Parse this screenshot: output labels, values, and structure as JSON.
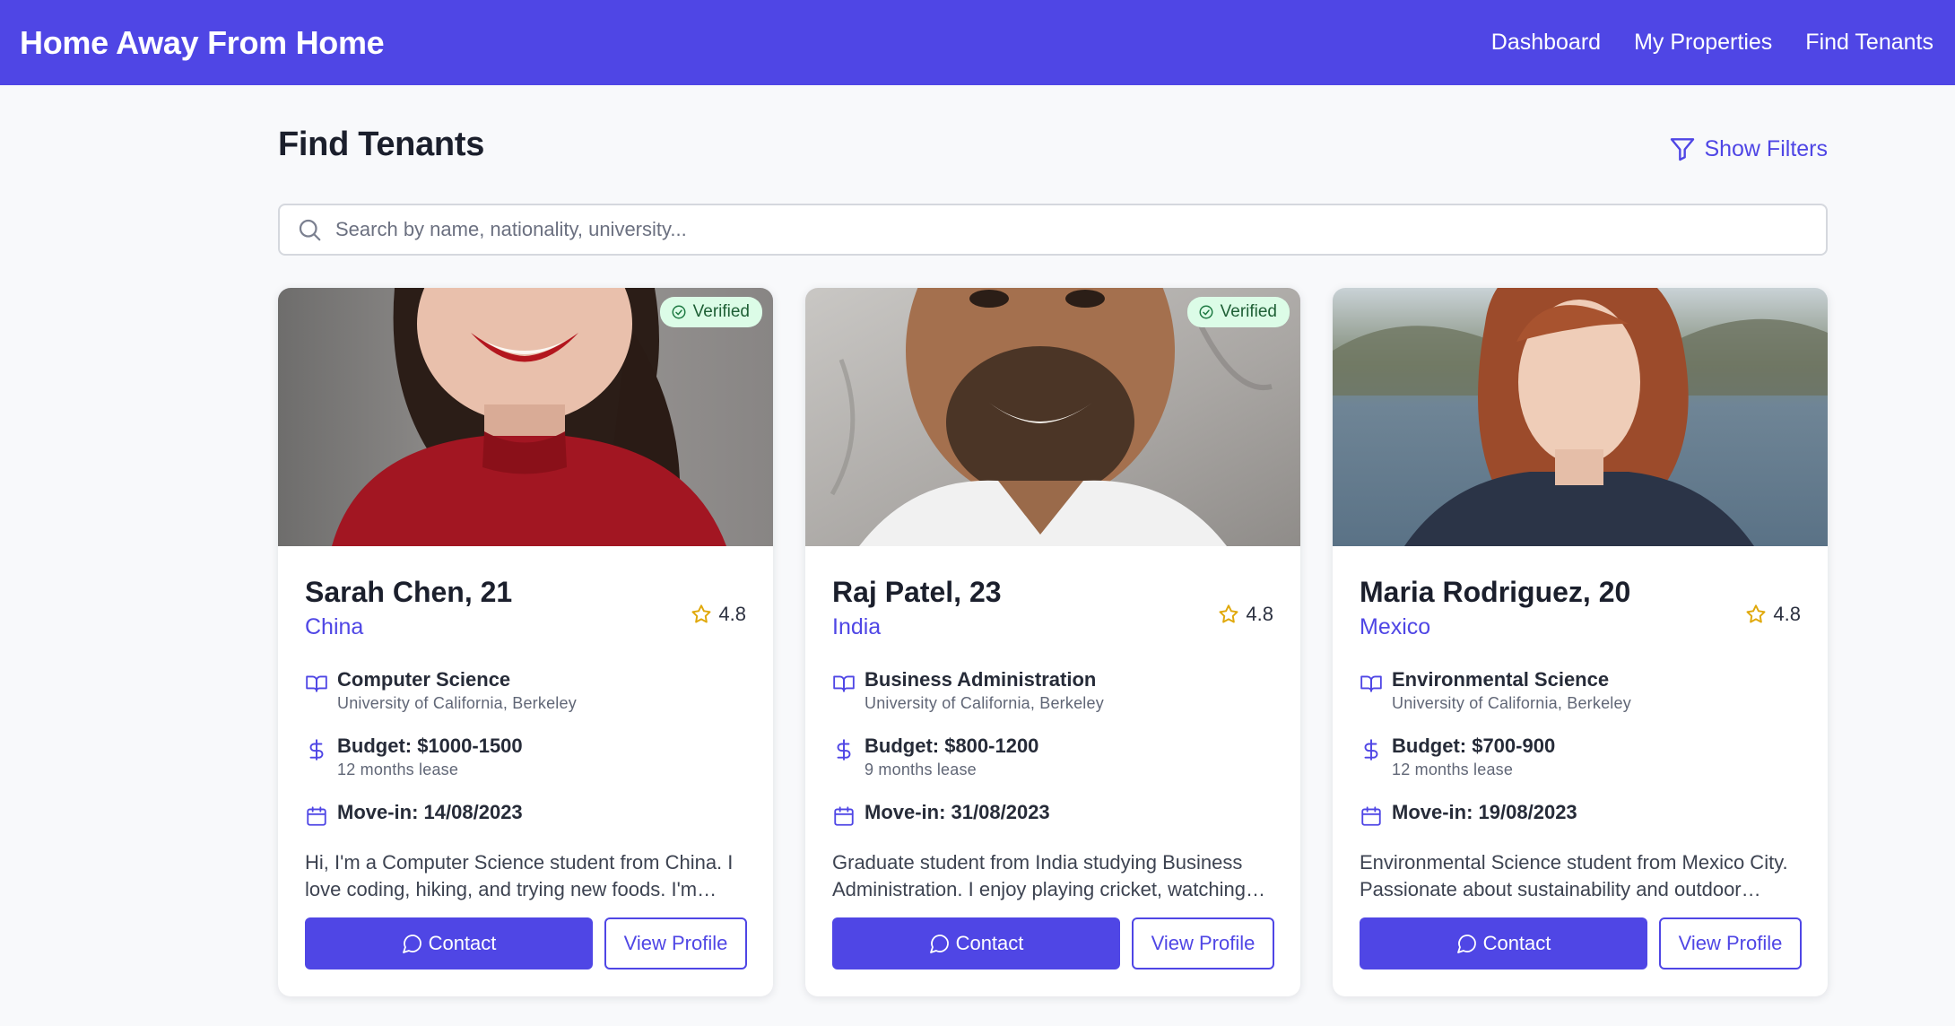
{
  "app": {
    "brand": "Home Away From Home",
    "nav": [
      "Dashboard",
      "My Properties",
      "Find Tenants"
    ]
  },
  "page": {
    "title": "Find Tenants",
    "filters_label": "Show Filters",
    "search_placeholder": "Search by name, nationality, university..."
  },
  "colors": {
    "accent": "#4f46e5",
    "verified_bg": "#dcfce7",
    "star": "#e0a80a"
  },
  "tenants": [
    {
      "name": "Sarah Chen, 21",
      "nationality": "China",
      "verified": "Verified",
      "rating": "4.8",
      "major": "Computer Science",
      "university": "University of California, Berkeley",
      "budget": "Budget: $1000-1500",
      "lease": "12 months lease",
      "move_in": "Move-in: 14/08/2023",
      "bio": "Hi, I'm a Computer Science student from China. I love coding, hiking, and trying new foods. I'm looking for a quiet place close to campus.",
      "contact_label": "Contact",
      "profile_label": "View Profile"
    },
    {
      "name": "Raj Patel, 23",
      "nationality": "India",
      "verified": "Verified",
      "rating": "4.8",
      "major": "Business Administration",
      "university": "University of California, Berkeley",
      "budget": "Budget: $800-1200",
      "lease": "9 months lease",
      "move_in": "Move-in: 31/08/2023",
      "bio": "Graduate student from India studying Business Administration. I enjoy playing cricket, watching movies and cooking.",
      "contact_label": "Contact",
      "profile_label": "View Profile"
    },
    {
      "name": "Maria Rodriguez, 20",
      "nationality": "Mexico",
      "verified": "",
      "rating": "4.8",
      "major": "Environmental Science",
      "university": "University of California, Berkeley",
      "budget": "Budget: $700-900",
      "lease": "12 months lease",
      "move_in": "Move-in: 19/08/2023",
      "bio": "Environmental Science student from Mexico City. Passionate about sustainability and outdoor activities.",
      "contact_label": "Contact",
      "profile_label": "View Profile"
    }
  ]
}
